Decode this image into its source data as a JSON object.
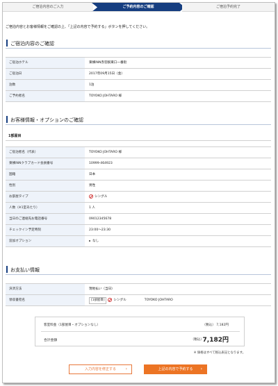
{
  "steps": [
    {
      "label": "ご宿泊内容のご入力"
    },
    {
      "label": "ご予約内容のご確認"
    },
    {
      "label": "ご宿泊予約完了"
    }
  ],
  "intro": "ご宿泊内容とお客様情報をご確認の上、「上記の内容で予約する」ボタンを押してください。",
  "stay": {
    "title": "ご宿泊内容のご確認",
    "rows": [
      {
        "label": "ご宿泊ホテル",
        "value": "東横INN赤羽駅東口一番街"
      },
      {
        "label": "ご宿泊日",
        "value": "2017年09月15日（金）"
      },
      {
        "label": "泊数",
        "value": "1泊"
      },
      {
        "label": "ご予約者名",
        "value": "TOYOKO JOHTARO 様"
      }
    ]
  },
  "guest": {
    "title": "お客様情報・オプションのご確認",
    "room_heading": "1部屋目",
    "rows": [
      {
        "label": "ご宿泊者名（代表）",
        "value": "TOYOKO JOHTARO 様"
      },
      {
        "label": "東横INNクラブカード会員番号",
        "value": "10999-464923"
      },
      {
        "label": "国籍",
        "value": "日本"
      },
      {
        "label": "性別",
        "value": "男性"
      },
      {
        "label": "お部屋タイプ",
        "value": "シングル"
      },
      {
        "label": "人数（※1室あたり）",
        "value": "1 人"
      },
      {
        "label": "当日のご連絡先お電話番号",
        "value": "09012345678"
      },
      {
        "label": "チェックイン予定時刻",
        "value": "23:00～23:30"
      },
      {
        "label": "追加オプション",
        "value": "なし"
      }
    ]
  },
  "payment": {
    "title": "お支払い情報",
    "rows": [
      {
        "label": "決済方法",
        "value": "現地払い（当日）"
      },
      {
        "label": "領収書宛名",
        "tag": "1部屋目",
        "room_type": "シングル",
        "value": "TOYOKO JOHTARO"
      }
    ]
  },
  "totals": {
    "room_fee_label": "客室料金（1部屋目・オプションなし）",
    "room_fee_value": "（税込） 7,182円",
    "total_label": "合計金額",
    "total_tax": "（税込）",
    "total_value": "7,182円",
    "note": "※ 価格はすべて税込表記となります。"
  },
  "buttons": {
    "back": "入力内容を修正する",
    "submit": "上記の内容で予約する"
  },
  "colors": {
    "accent": "#163e80",
    "button": "#ec7424",
    "label_bg": "#eef3fa"
  }
}
